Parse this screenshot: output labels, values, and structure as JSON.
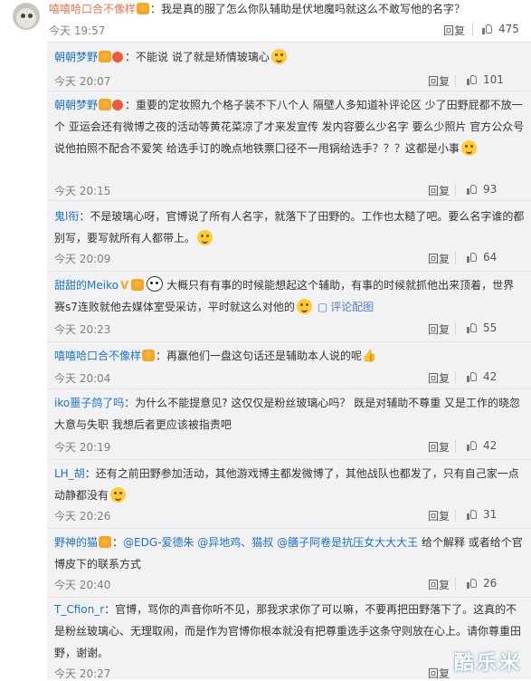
{
  "top_comment": {
    "user": "嘻嘻哈口合不像样",
    "separator": "：",
    "text": "我是真的服了怎么你队辅助是伏地魔吗就这么不敢写他的名字？",
    "time": "今天 19:57",
    "reply_label": "回复",
    "likes": "475"
  },
  "replies": [
    {
      "user": "朝朝梦野",
      "text": "：不能说 说了就是矫情玻璃心",
      "time": "今天 20:07",
      "reply_label": "回复",
      "likes": "101"
    },
    {
      "user": "朝朝梦野",
      "text": "：重要的定妆照九个格子装不下八个人 隔壁人多知道补评论区 少了田野屁都不放一个 亚运会还有微博之夜的活动等黄花菜凉了才来发宣传 发内容要么少名字 要么少照片 官方公众号说他拍照不配合不爱笑 给选手订的晚点地铁票囗径不一甩锅给选手？？？这都是小事",
      "time": "今天 20:15",
      "reply_label": "回复",
      "likes": "93"
    },
    {
      "user": "鬼l衔",
      "text": "：不是玻璃心呀，官博说了所有人名字，就落下了田野的。工作也太糙了吧。要么名字谁的都别写，要写就所有人都带上。",
      "time": "今天 20:09",
      "reply_label": "回复",
      "likes": "64"
    },
    {
      "user": "甜甜的Meiko",
      "text": "大概只有有事的时候能想起这个辅助，有事的时候就抓他出来顶着，世界赛s7连败就他去媒体室受采访，平时就这么对他的",
      "pic_label": "评论配图",
      "time": "今天 20:23",
      "reply_label": "回复",
      "likes": "55"
    },
    {
      "user": "嘻嘻哈口合不像样",
      "text": "：再赢他们一盘这句话还是辅助本人说的呢",
      "time": "今天 20:04",
      "reply_label": "回复",
      "likes": "42"
    },
    {
      "user": "iko噩子鸽了吗",
      "text": "：为什么不能提意见? 这仅仅是粉丝玻璃心吗？ 既是对辅助不尊重 又是工作的晓忽大意与失职 我想后者更应该被指责吧",
      "time": "今天 20:19",
      "reply_label": "回复",
      "likes": "42"
    },
    {
      "user": "LH_胡",
      "text": "：还有之前田野参加活动，其他游戏博主都发微博了，其他战队也都发了，只有自己家一点动静都没有",
      "time": "今天 20:26",
      "reply_label": "回复",
      "likes": "31"
    },
    {
      "user": "野神的猫",
      "text_pre": "：",
      "mentions": "@EDG-爱德朱 @异地鸡、猫叔 @膳子阿卷是抗压女大大大王",
      "text_post": " 给个解释 或者给个官博皮下的联系方式",
      "time": "今天 20:40",
      "reply_label": "回复",
      "likes": "26"
    },
    {
      "user": "T_Cfion_r",
      "text": "：官博，骂你的声音你听不见，那我求求你了可以嘛，不要再把田野落下了。这真的不是粉丝玻璃心、无理取闹，而是作为官博你根本就没有把尊重选手这条守则放在心上。请你尊重田野，谢谢。",
      "time": "今天 20:27",
      "reply_label": "回复",
      "likes": ""
    }
  ],
  "watermark": "酷乐米"
}
